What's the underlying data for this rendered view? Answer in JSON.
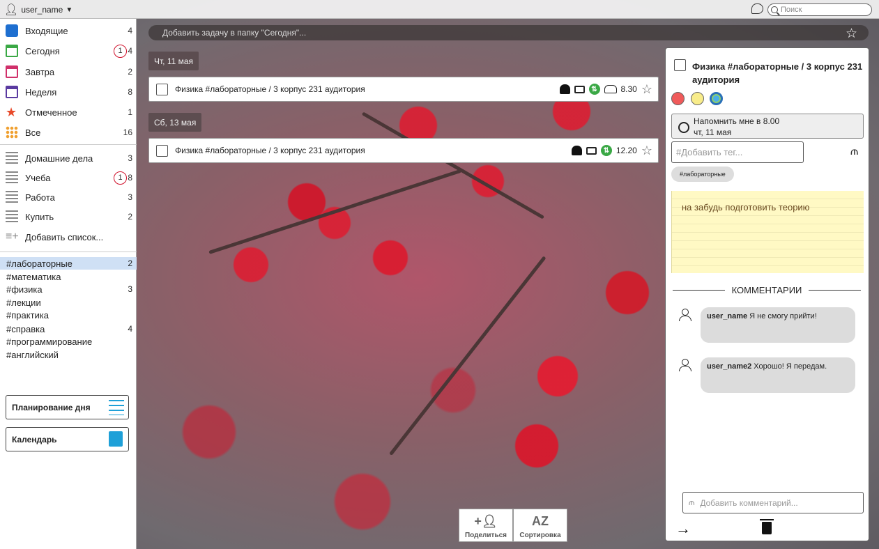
{
  "topbar": {
    "username": "user_name",
    "search_placeholder": "Поиск"
  },
  "sidebar": {
    "items": [
      {
        "label": "Входящие",
        "count": "4",
        "icon": "inbox-icon",
        "color": "#1e6fd0"
      },
      {
        "label": "Сегодня",
        "count": "4",
        "badge": "1",
        "icon": "calendar-today-icon",
        "color": "#3aa845"
      },
      {
        "label": "Завтра",
        "count": "2",
        "icon": "calendar-tomorrow-icon",
        "color": "#d0306a"
      },
      {
        "label": "Неделя",
        "count": "8",
        "icon": "calendar-week-icon",
        "color": "#5a3aa0"
      },
      {
        "label": "Отмеченное",
        "count": "1",
        "icon": "star-icon",
        "color": "#e84a2a"
      },
      {
        "label": "Все",
        "count": "16",
        "icon": "grid-icon",
        "color": "#f0a030"
      }
    ],
    "lists": [
      {
        "label": "Домашние дела",
        "count": "3"
      },
      {
        "label": "Учеба",
        "count": "8",
        "badge": "1"
      },
      {
        "label": "Работа",
        "count": "3"
      },
      {
        "label": "Купить",
        "count": "2"
      }
    ],
    "add_list_label": "Добавить список...",
    "tags": [
      {
        "label": "#лабораторные",
        "count": "2"
      },
      {
        "label": "#математика",
        "count": ""
      },
      {
        "label": "#физика",
        "count": "3"
      },
      {
        "label": "#лекции",
        "count": ""
      },
      {
        "label": "#практика",
        "count": ""
      },
      {
        "label": "#справка",
        "count": "4"
      },
      {
        "label": "#программирование",
        "count": ""
      },
      {
        "label": "#английский",
        "count": ""
      }
    ],
    "planning_label": "Планирование дня",
    "calendar_label": "Календарь"
  },
  "main": {
    "add_task_placeholder": "Добавить задачу в папку \"Сегодня\"...",
    "groups": [
      {
        "date": "Чт, 11 мая",
        "task": {
          "title": "Физика #лабораторные / 3 корпус 231 аудитория",
          "time": "8.30",
          "shared": true
        }
      },
      {
        "date": "Сб, 13 мая",
        "task": {
          "title": "Физика #лабораторные / 3 корпус 231 аудитория",
          "time": "12.20",
          "shared": false
        }
      }
    ],
    "share_label": "Поделиться",
    "sort_label": "Сортировка",
    "sort_icon_text": "AZ"
  },
  "detail": {
    "title": "Физика #лабораторные / 3 корпус 231 аудитория",
    "colors": [
      "#f05a5a",
      "#f8ec8a",
      "#4ab0e8"
    ],
    "remind_line1": "Напомнить мне в 8.00",
    "remind_line2": "чт, 11 мая",
    "tag_placeholder": "#Добавить тег...",
    "tag": "#лабораторные",
    "note": "на забудь подготовить теорию",
    "comments_header": "КОММЕНТАРИИ",
    "comments": [
      {
        "user": "user_name",
        "text": "Я не смогу прийти!"
      },
      {
        "user": "user_name2",
        "text": "Хорошо! Я передам."
      }
    ],
    "comment_placeholder": "Добавить комментарий..."
  }
}
